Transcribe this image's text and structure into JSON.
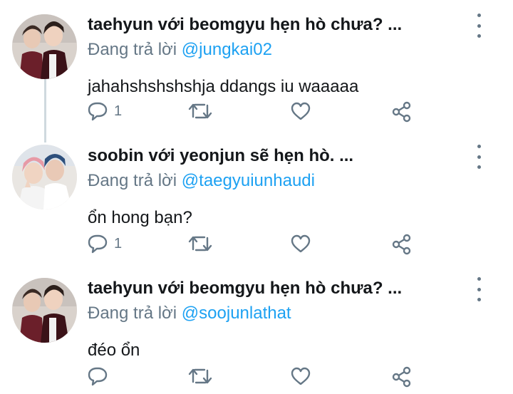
{
  "tweets": [
    {
      "author_line": "taehyun với beomgyu hẹn hò chưa? ...",
      "replying_prefix": "Đang trả lời ",
      "replying_handle": "@jungkai02",
      "text": "jahahshshshshja ddangs iu waaaaa",
      "reply_count": "1"
    },
    {
      "author_line": "soobin với yeonjun sẽ hẹn hò. ...",
      "replying_prefix": "Đang trả lời ",
      "replying_handle": "@taegyuiunhaudi",
      "text": "ổn hong bạn?",
      "reply_count": "1"
    },
    {
      "author_line": "taehyun với beomgyu hẹn hò chưa? ...",
      "replying_prefix": "Đang trả lời ",
      "replying_handle": "@soojunlathat",
      "text": "đéo ổn",
      "reply_count": ""
    }
  ],
  "colors": {
    "text": "#14171a",
    "secondary": "#657786",
    "link": "#1da1f2",
    "thread_line": "#cfd9de"
  },
  "icons": [
    "reply-icon",
    "retweet-icon",
    "like-icon",
    "share-icon",
    "more-options-icon"
  ]
}
